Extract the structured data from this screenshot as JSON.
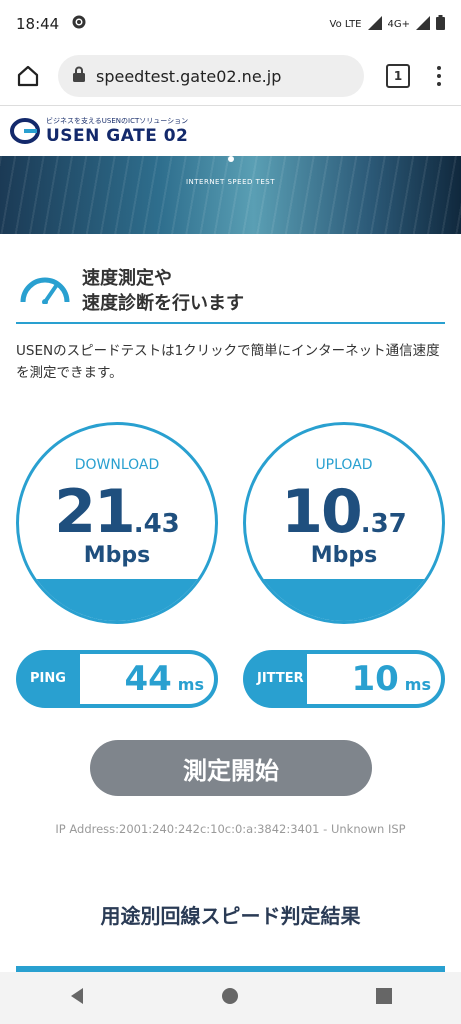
{
  "status": {
    "time": "18:44",
    "volte": "Vo LTE",
    "network": "4G+"
  },
  "browser": {
    "url": "speedtest.gate02.ne.jp",
    "tab_count": "1"
  },
  "site": {
    "tagline": "ビジネスを支えるUSENのICTソリューション",
    "logo": "USEN GATE 02",
    "hero_text": "INTERNET SPEED TEST"
  },
  "section": {
    "title_line1": "速度測定や",
    "title_line2": "速度診断を行います",
    "description": "USENのスピードテストは1クリックで簡単にインターネット通信速度を測定できます。"
  },
  "download": {
    "label": "DOWNLOAD",
    "int": "21",
    "dec": ".43",
    "unit": "Mbps"
  },
  "upload": {
    "label": "UPLOAD",
    "int": "10",
    "dec": ".37",
    "unit": "Mbps"
  },
  "ping": {
    "label": "PING",
    "value": "44",
    "unit": "ms"
  },
  "jitter": {
    "label": "JITTER",
    "value": "10",
    "unit": "ms"
  },
  "start_button": "測定開始",
  "ip_text": "IP Address:2001:240:242c:10c:0:a:3842:3401 - Unknown ISP",
  "bottom_title": "用途別回線スピード判定結果",
  "colors": {
    "accent": "#29a0d0",
    "value": "#1f4f7e",
    "button": "#7f858c",
    "brand": "#13296b"
  }
}
